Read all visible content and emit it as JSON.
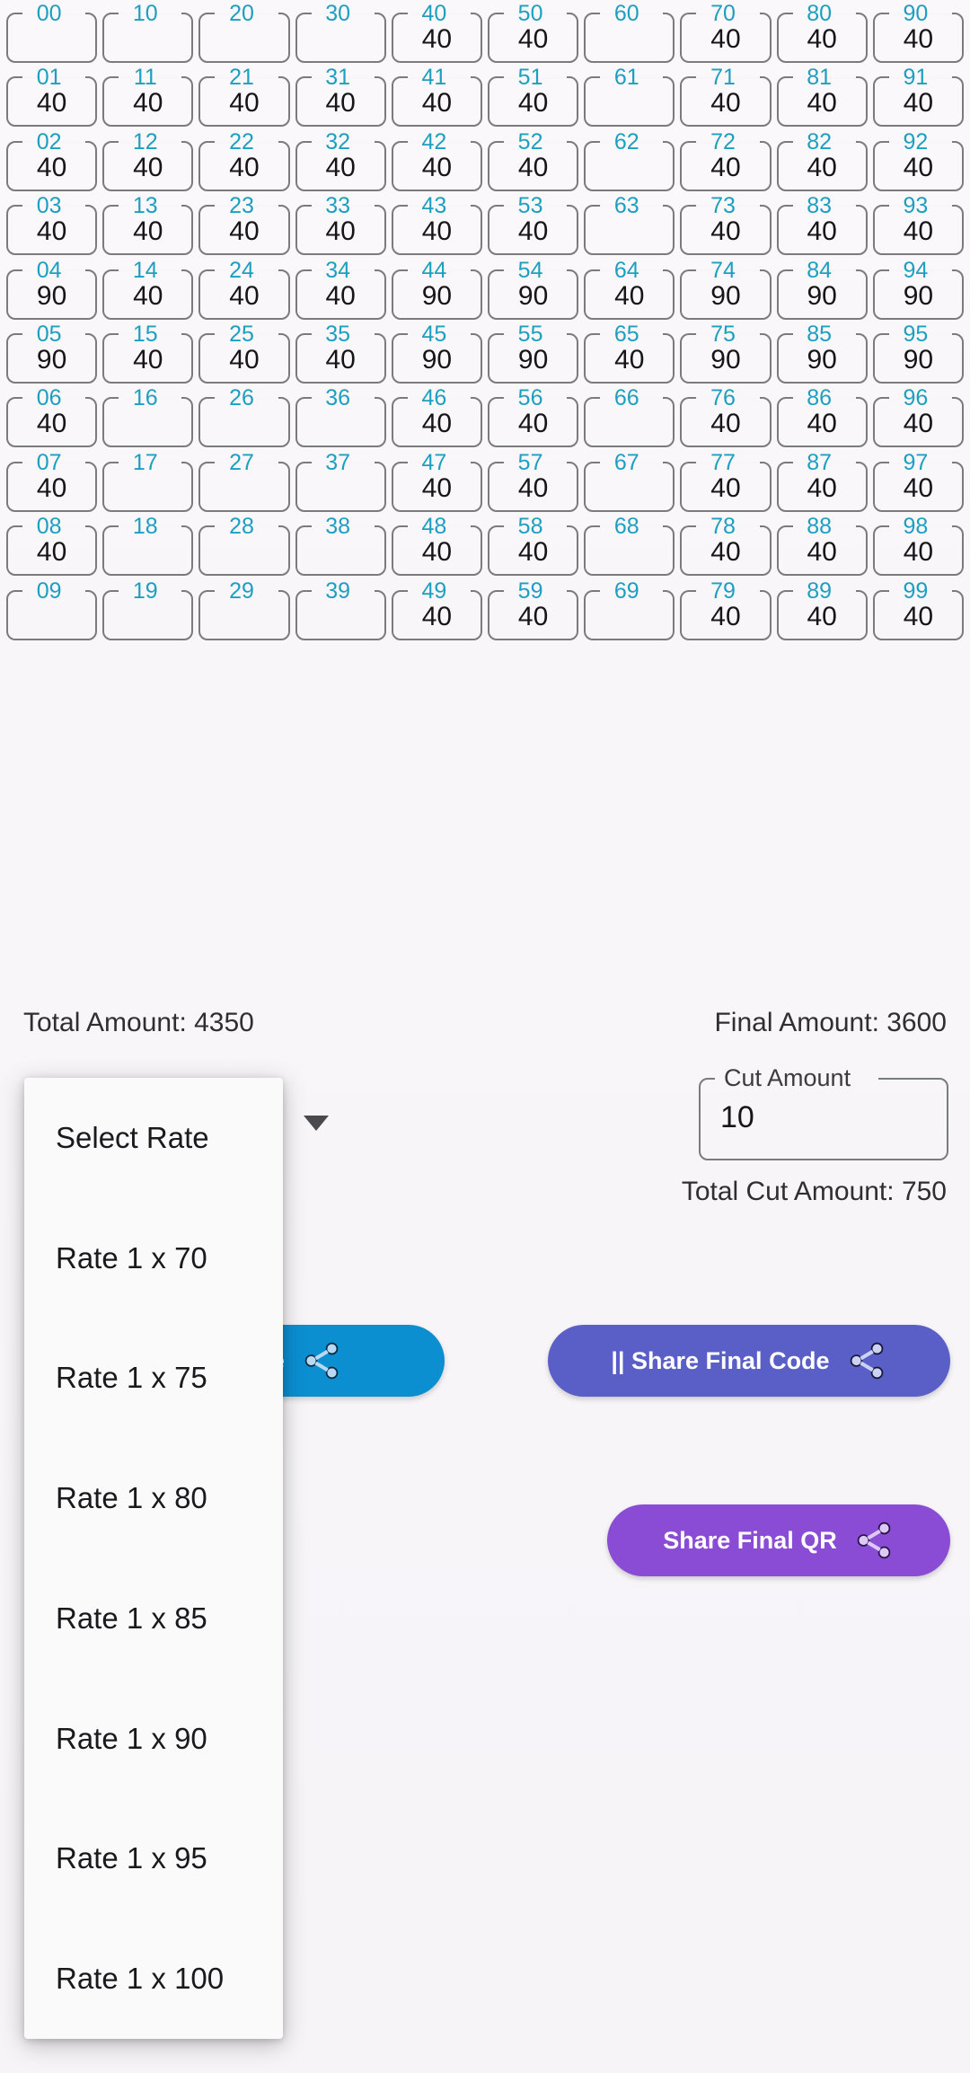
{
  "colors": {
    "label_teal": "#1d9fc0",
    "border_grey": "#7b7b7e",
    "page_bg": "#f8f6f8",
    "share_code_blue": "#0b8fd1",
    "share_final_code_indigo": "#5a5fc7",
    "share_final_qr_purple": "#8a4cd4"
  },
  "grid": {
    "columns": 10,
    "rows": 10,
    "cells": [
      [
        {
          "label": "00",
          "value": ""
        },
        {
          "label": "10",
          "value": ""
        },
        {
          "label": "20",
          "value": ""
        },
        {
          "label": "30",
          "value": ""
        },
        {
          "label": "40",
          "value": "40"
        },
        {
          "label": "50",
          "value": "40"
        },
        {
          "label": "60",
          "value": ""
        },
        {
          "label": "70",
          "value": "40"
        },
        {
          "label": "80",
          "value": "40"
        },
        {
          "label": "90",
          "value": "40"
        }
      ],
      [
        {
          "label": "01",
          "value": "40"
        },
        {
          "label": "11",
          "value": "40"
        },
        {
          "label": "21",
          "value": "40"
        },
        {
          "label": "31",
          "value": "40"
        },
        {
          "label": "41",
          "value": "40"
        },
        {
          "label": "51",
          "value": "40"
        },
        {
          "label": "61",
          "value": ""
        },
        {
          "label": "71",
          "value": "40"
        },
        {
          "label": "81",
          "value": "40"
        },
        {
          "label": "91",
          "value": "40"
        }
      ],
      [
        {
          "label": "02",
          "value": "40"
        },
        {
          "label": "12",
          "value": "40"
        },
        {
          "label": "22",
          "value": "40"
        },
        {
          "label": "32",
          "value": "40"
        },
        {
          "label": "42",
          "value": "40"
        },
        {
          "label": "52",
          "value": "40"
        },
        {
          "label": "62",
          "value": ""
        },
        {
          "label": "72",
          "value": "40"
        },
        {
          "label": "82",
          "value": "40"
        },
        {
          "label": "92",
          "value": "40"
        }
      ],
      [
        {
          "label": "03",
          "value": "40"
        },
        {
          "label": "13",
          "value": "40"
        },
        {
          "label": "23",
          "value": "40"
        },
        {
          "label": "33",
          "value": "40"
        },
        {
          "label": "43",
          "value": "40"
        },
        {
          "label": "53",
          "value": "40"
        },
        {
          "label": "63",
          "value": ""
        },
        {
          "label": "73",
          "value": "40"
        },
        {
          "label": "83",
          "value": "40"
        },
        {
          "label": "93",
          "value": "40"
        }
      ],
      [
        {
          "label": "04",
          "value": "90"
        },
        {
          "label": "14",
          "value": "40"
        },
        {
          "label": "24",
          "value": "40"
        },
        {
          "label": "34",
          "value": "40"
        },
        {
          "label": "44",
          "value": "90"
        },
        {
          "label": "54",
          "value": "90"
        },
        {
          "label": "64",
          "value": "40"
        },
        {
          "label": "74",
          "value": "90"
        },
        {
          "label": "84",
          "value": "90"
        },
        {
          "label": "94",
          "value": "90"
        }
      ],
      [
        {
          "label": "05",
          "value": "90"
        },
        {
          "label": "15",
          "value": "40"
        },
        {
          "label": "25",
          "value": "40"
        },
        {
          "label": "35",
          "value": "40"
        },
        {
          "label": "45",
          "value": "90"
        },
        {
          "label": "55",
          "value": "90"
        },
        {
          "label": "65",
          "value": "40"
        },
        {
          "label": "75",
          "value": "90"
        },
        {
          "label": "85",
          "value": "90"
        },
        {
          "label": "95",
          "value": "90"
        }
      ],
      [
        {
          "label": "06",
          "value": "40"
        },
        {
          "label": "16",
          "value": ""
        },
        {
          "label": "26",
          "value": ""
        },
        {
          "label": "36",
          "value": ""
        },
        {
          "label": "46",
          "value": "40"
        },
        {
          "label": "56",
          "value": "40"
        },
        {
          "label": "66",
          "value": ""
        },
        {
          "label": "76",
          "value": "40"
        },
        {
          "label": "86",
          "value": "40"
        },
        {
          "label": "96",
          "value": "40"
        }
      ],
      [
        {
          "label": "07",
          "value": "40"
        },
        {
          "label": "17",
          "value": ""
        },
        {
          "label": "27",
          "value": ""
        },
        {
          "label": "37",
          "value": ""
        },
        {
          "label": "47",
          "value": "40"
        },
        {
          "label": "57",
          "value": "40"
        },
        {
          "label": "67",
          "value": ""
        },
        {
          "label": "77",
          "value": "40"
        },
        {
          "label": "87",
          "value": "40"
        },
        {
          "label": "97",
          "value": "40"
        }
      ],
      [
        {
          "label": "08",
          "value": "40"
        },
        {
          "label": "18",
          "value": ""
        },
        {
          "label": "28",
          "value": ""
        },
        {
          "label": "38",
          "value": ""
        },
        {
          "label": "48",
          "value": "40"
        },
        {
          "label": "58",
          "value": "40"
        },
        {
          "label": "68",
          "value": ""
        },
        {
          "label": "78",
          "value": "40"
        },
        {
          "label": "88",
          "value": "40"
        },
        {
          "label": "98",
          "value": "40"
        }
      ],
      [
        {
          "label": "09",
          "value": ""
        },
        {
          "label": "19",
          "value": ""
        },
        {
          "label": "29",
          "value": ""
        },
        {
          "label": "39",
          "value": ""
        },
        {
          "label": "49",
          "value": "40"
        },
        {
          "label": "59",
          "value": "40"
        },
        {
          "label": "69",
          "value": ""
        },
        {
          "label": "79",
          "value": "40"
        },
        {
          "label": "89",
          "value": "40"
        },
        {
          "label": "99",
          "value": "40"
        }
      ]
    ]
  },
  "totals": {
    "total_amount": "Total Amount: 4350",
    "final_amount": "Final Amount: 3600",
    "total_cut_amount": "Total Cut Amount: 750"
  },
  "rate_select": {
    "selected_label": "",
    "caret_icon": "chevron-down-icon"
  },
  "cut_amount": {
    "label": "Cut Amount",
    "value": "10",
    "placeholder": "Cut Amount"
  },
  "buttons": {
    "share_code": {
      "label": "ode",
      "icon": "share-icon"
    },
    "share_final_code": {
      "label": "|| Share Final Code",
      "icon": "share-icon"
    },
    "share_final_qr": {
      "label": "Share Final QR",
      "icon": "share-icon"
    }
  },
  "dropdown": {
    "open": true,
    "items": [
      "Select Rate",
      "Rate 1 x 70",
      "Rate 1 x 75",
      "Rate 1 x 80",
      "Rate 1 x 85",
      "Rate 1 x 90",
      "Rate 1 x 95",
      "Rate 1 x 100"
    ]
  }
}
